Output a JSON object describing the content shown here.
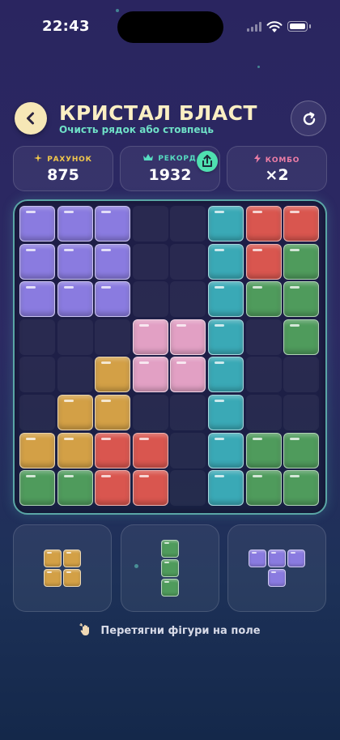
{
  "status_bar": {
    "time": "22:43"
  },
  "header": {
    "title": "КРИСТАЛ БЛАСТ",
    "subtitle": "Очисть рядок або стовпець",
    "back_icon": "chevron-left-icon",
    "restart_icon": "refresh-icon"
  },
  "stats": [
    {
      "label": "РАХУНОК",
      "value": "875",
      "icon": "sparkle-icon",
      "label_color": "#f2c84b"
    },
    {
      "label": "РЕКОРД",
      "value": "1932",
      "icon": "crown-icon",
      "label_color": "#56dcc0"
    },
    {
      "label": "КОМБО",
      "value": "×2",
      "icon": "lightning-icon",
      "label_color": "#ee7ea6"
    }
  ],
  "colors": {
    "P": "#8a7be0",
    "T": "#3aa9b6",
    "R": "#d9564f",
    "G": "#4f9b5c",
    "K": "#e2a0c4",
    "Y": "#d3a046"
  },
  "board": [
    [
      "P",
      "P",
      "P",
      ".",
      ".",
      "T",
      "R",
      "R"
    ],
    [
      "P",
      "P",
      "P",
      ".",
      ".",
      "T",
      "R",
      "G"
    ],
    [
      "P",
      "P",
      "P",
      ".",
      ".",
      "T",
      "G",
      "G"
    ],
    [
      ".",
      ".",
      ".",
      "K",
      "K",
      "T",
      ".",
      "G"
    ],
    [
      ".",
      ".",
      "Y",
      "K",
      "K",
      "T",
      ".",
      "."
    ],
    [
      ".",
      "Y",
      "Y",
      ".",
      ".",
      "T",
      ".",
      "."
    ],
    [
      "Y",
      "Y",
      "R",
      "R",
      ".",
      "T",
      "G",
      "G"
    ],
    [
      "G",
      "G",
      "R",
      "R",
      ".",
      "T",
      "G",
      "G"
    ]
  ],
  "tray": [
    {
      "color": "Y",
      "cells": [
        [
          0,
          0
        ],
        [
          0,
          1
        ],
        [
          1,
          0
        ],
        [
          1,
          1
        ]
      ]
    },
    {
      "color": "G",
      "cells": [
        [
          0,
          0
        ],
        [
          1,
          0
        ],
        [
          2,
          0
        ]
      ]
    },
    {
      "color": "P",
      "cells": [
        [
          0,
          0
        ],
        [
          0,
          1
        ],
        [
          0,
          2
        ],
        [
          1,
          1
        ]
      ]
    }
  ],
  "hint": {
    "text": "Перетягни фігури на поле",
    "icon": "drag-hand-icon"
  }
}
